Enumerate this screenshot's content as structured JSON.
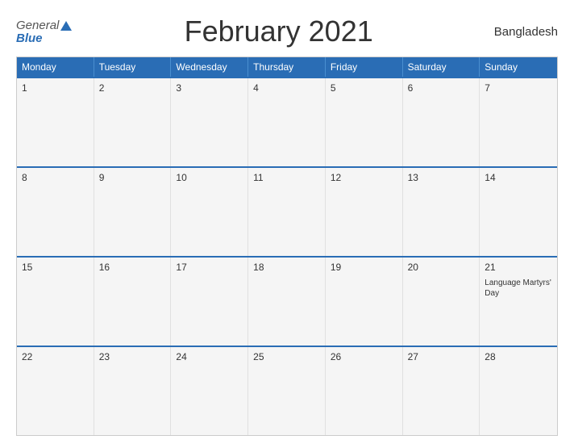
{
  "header": {
    "title": "February 2021",
    "country": "Bangladesh",
    "logo_general": "General",
    "logo_blue": "Blue"
  },
  "weekdays": [
    "Monday",
    "Tuesday",
    "Wednesday",
    "Thursday",
    "Friday",
    "Saturday",
    "Sunday"
  ],
  "weeks": [
    [
      {
        "day": "1",
        "events": []
      },
      {
        "day": "2",
        "events": []
      },
      {
        "day": "3",
        "events": []
      },
      {
        "day": "4",
        "events": []
      },
      {
        "day": "5",
        "events": []
      },
      {
        "day": "6",
        "events": []
      },
      {
        "day": "7",
        "events": []
      }
    ],
    [
      {
        "day": "8",
        "events": []
      },
      {
        "day": "9",
        "events": []
      },
      {
        "day": "10",
        "events": []
      },
      {
        "day": "11",
        "events": []
      },
      {
        "day": "12",
        "events": []
      },
      {
        "day": "13",
        "events": []
      },
      {
        "day": "14",
        "events": []
      }
    ],
    [
      {
        "day": "15",
        "events": []
      },
      {
        "day": "16",
        "events": []
      },
      {
        "day": "17",
        "events": []
      },
      {
        "day": "18",
        "events": []
      },
      {
        "day": "19",
        "events": []
      },
      {
        "day": "20",
        "events": []
      },
      {
        "day": "21",
        "events": [
          "Language Martyrs' Day"
        ]
      }
    ],
    [
      {
        "day": "22",
        "events": []
      },
      {
        "day": "23",
        "events": []
      },
      {
        "day": "24",
        "events": []
      },
      {
        "day": "25",
        "events": []
      },
      {
        "day": "26",
        "events": []
      },
      {
        "day": "27",
        "events": []
      },
      {
        "day": "28",
        "events": []
      }
    ]
  ]
}
